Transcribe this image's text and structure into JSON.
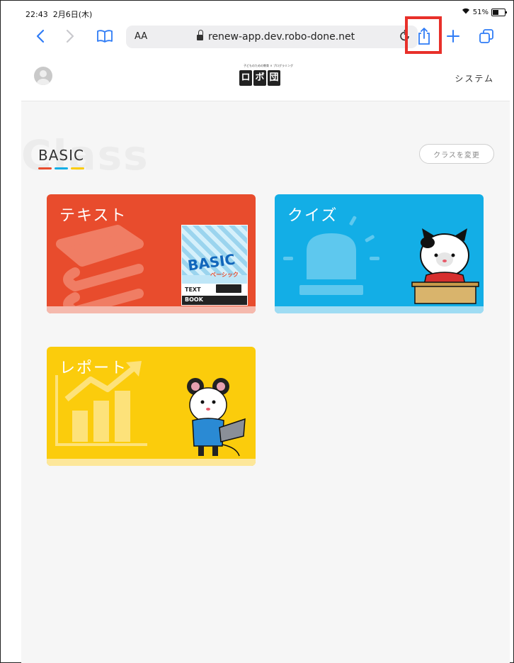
{
  "status_bar": {
    "time": "22:43",
    "date": "2月6日(木)",
    "battery": "51%"
  },
  "browser": {
    "text_size_label": "AA",
    "url": "renew-app.dev.robo-done.net"
  },
  "header": {
    "logo_mark": "ロボ団",
    "logo_tagline": "子どものための教育 × プログラミング",
    "system_label": "システム"
  },
  "class_section": {
    "ghost_text": "Class",
    "class_name": "BASIC",
    "change_button": "クラスを変更",
    "underline_colors": [
      "#e84c2d",
      "#13aee6",
      "#fbcc0c"
    ]
  },
  "cards": [
    {
      "label": "テキスト",
      "color": "#e84c2d",
      "book_title": "BASIC",
      "book_subtitle": "ベーシック",
      "book_footer1": "TEXT",
      "book_footer2": "BOOK"
    },
    {
      "label": "クイズ",
      "color": "#13aee6"
    },
    {
      "label": "レポート",
      "color": "#fbcc0c"
    }
  ]
}
